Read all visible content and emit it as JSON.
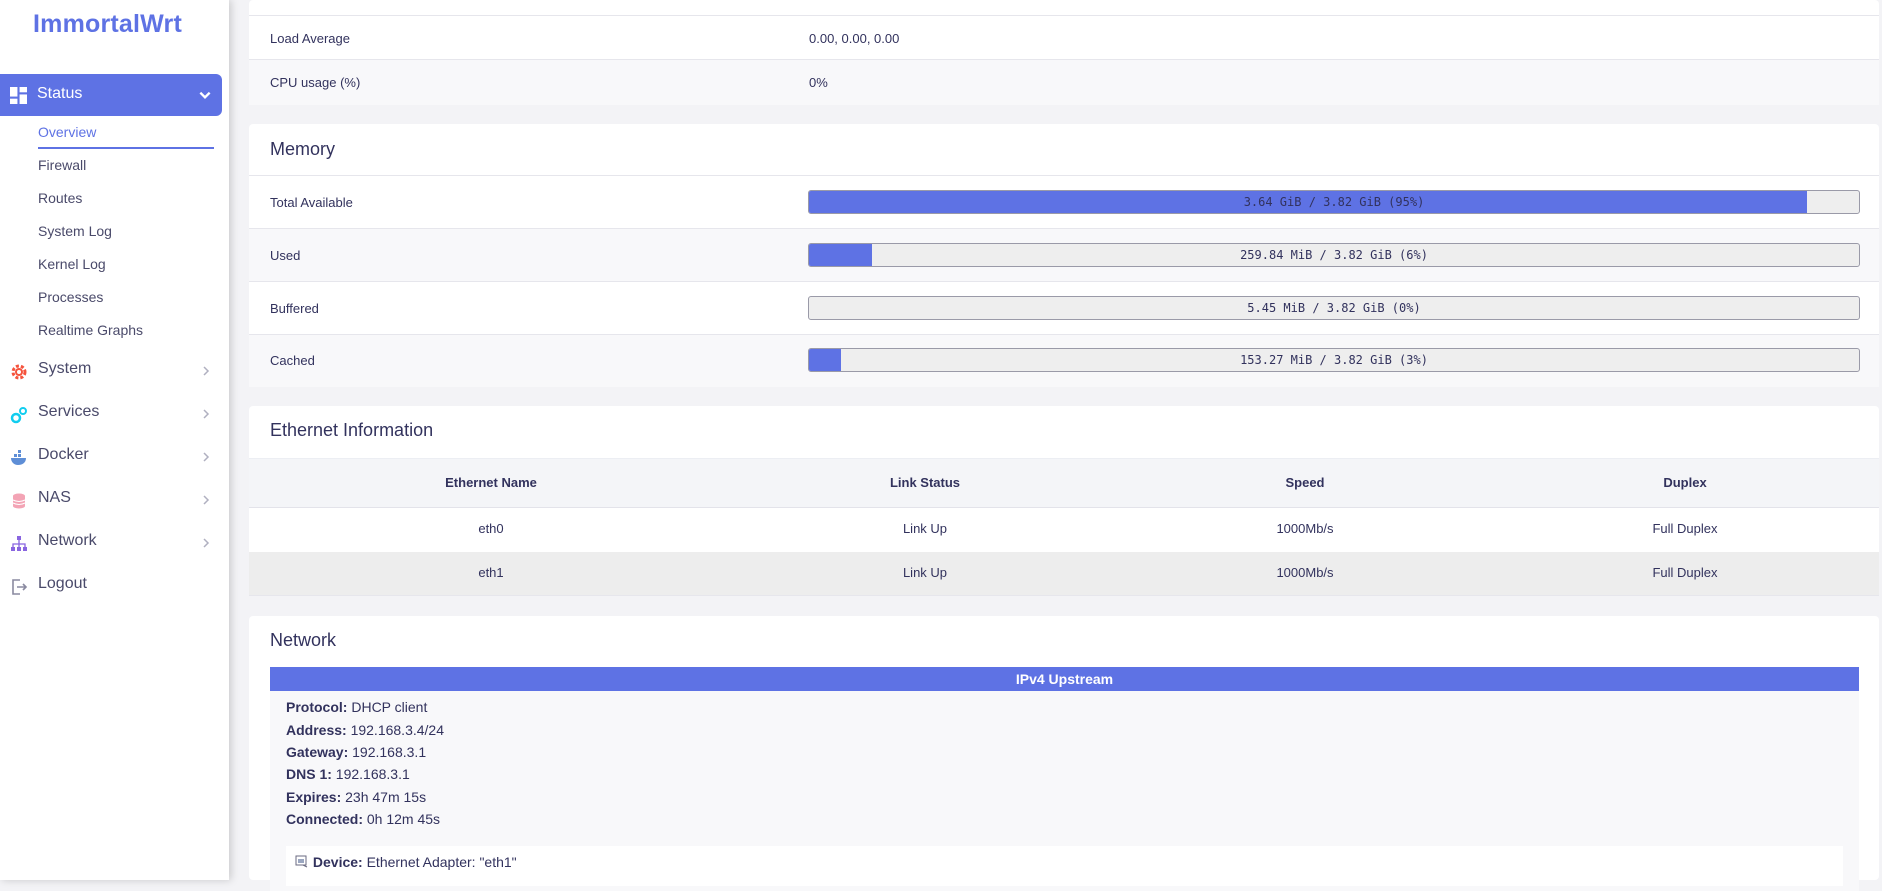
{
  "brand": "ImmortalWrt",
  "accent": "#5e72e4",
  "sidebar": {
    "active": {
      "label": "Status",
      "icon": "dashboard-icon"
    },
    "subitems": [
      {
        "label": "Overview",
        "active": true
      },
      {
        "label": "Firewall"
      },
      {
        "label": "Routes"
      },
      {
        "label": "System Log"
      },
      {
        "label": "Kernel Log"
      },
      {
        "label": "Processes"
      },
      {
        "label": "Realtime Graphs"
      }
    ],
    "items": [
      {
        "label": "System",
        "icon": "gear-icon"
      },
      {
        "label": "Services",
        "icon": "services-icon"
      },
      {
        "label": "Docker",
        "icon": "docker-icon"
      },
      {
        "label": "NAS",
        "icon": "database-icon"
      },
      {
        "label": "Network",
        "icon": "network-icon"
      },
      {
        "label": "Logout",
        "icon": "logout-icon"
      }
    ]
  },
  "system": {
    "rows": [
      {
        "key": "Load Average",
        "value": "0.00, 0.00, 0.00"
      },
      {
        "key": "CPU usage (%)",
        "value": "0%"
      }
    ]
  },
  "memory": {
    "title": "Memory",
    "rows": [
      {
        "key": "Total Available",
        "text": "3.64 GiB / 3.82 GiB (95%)",
        "percent": 95
      },
      {
        "key": "Used",
        "text": "259.84 MiB / 3.82 GiB (6%)",
        "percent": 6
      },
      {
        "key": "Buffered",
        "text": "5.45 MiB / 3.82 GiB (0%)",
        "percent": 0
      },
      {
        "key": "Cached",
        "text": "153.27 MiB / 3.82 GiB (3%)",
        "percent": 3
      }
    ]
  },
  "ethernet": {
    "title": "Ethernet Information",
    "headers": [
      "Ethernet Name",
      "Link Status",
      "Speed",
      "Duplex"
    ],
    "rows": [
      [
        "eth0",
        "Link Up",
        "1000Mb/s",
        "Full Duplex"
      ],
      [
        "eth1",
        "Link Up",
        "1000Mb/s",
        "Full Duplex"
      ]
    ]
  },
  "network": {
    "title": "Network",
    "upstream_title": "IPv4 Upstream",
    "fields": [
      {
        "label": "Protocol:",
        "value": "DHCP client"
      },
      {
        "label": "Address:",
        "value": "192.168.3.4/24"
      },
      {
        "label": "Gateway:",
        "value": "192.168.3.1"
      },
      {
        "label": "DNS 1:",
        "value": "192.168.3.1"
      },
      {
        "label": "Expires:",
        "value": "23h 47m 15s"
      },
      {
        "label": "Connected:",
        "value": "0h 12m 45s"
      }
    ],
    "device": {
      "label": "Device:",
      "value": "Ethernet Adapter: \"eth1\"",
      "icon": "ethernet-port-icon"
    }
  }
}
